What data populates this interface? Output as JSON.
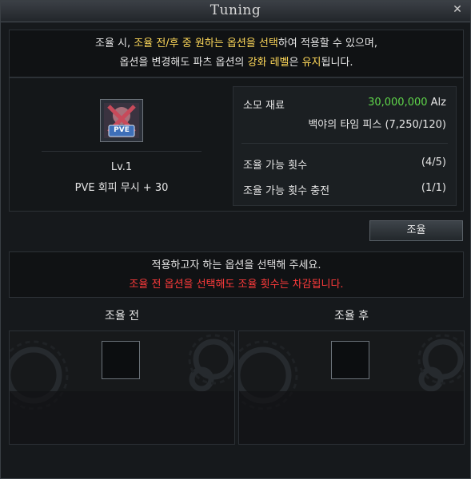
{
  "window": {
    "title": "Tuning",
    "close_icon": "close-icon"
  },
  "notice_top": {
    "line1": [
      {
        "text": "조율 시, ",
        "color": "white"
      },
      {
        "text": "조율 전/후 중 원하는 옵션을 선택",
        "color": "yellow"
      },
      {
        "text": "하여 적용할 수 있으며,",
        "color": "white"
      }
    ],
    "line2": [
      {
        "text": "옵션을 변경해도 파츠 옵션의 ",
        "color": "white"
      },
      {
        "text": "강화 레벨",
        "color": "yellow"
      },
      {
        "text": "은 ",
        "color": "white"
      },
      {
        "text": "유지",
        "color": "yellow"
      },
      {
        "text": "됩니다.",
        "color": "white"
      }
    ]
  },
  "item": {
    "icon": "pve-item-icon",
    "icon_label": "PVE",
    "level": "Lv.1",
    "option": "PVE 회피 무시  + 30"
  },
  "cost": {
    "label": "소모 재료",
    "amount": "30,000,000",
    "currency": "Alz",
    "material": "백야의 타임 피스 (7,250/120)"
  },
  "tuning": {
    "count_label": "조율 가능 횟수",
    "count_value": "(4/5)",
    "recharge_label": "조율 가능 횟수 충전",
    "recharge_value": "(1/1)"
  },
  "tune_button": "조율",
  "notice_bottom": {
    "line1": "적용하고자 하는 옵션을 선택해 주세요.",
    "line2": "조율 전 옵션을 선택해도 조율 횟수는 차감됩니다."
  },
  "columns": {
    "before": "조율 전",
    "after": "조율 후"
  },
  "colors": {
    "yellow": "#ffd95a",
    "red": "#ff3b3b",
    "green": "#5fd64a"
  }
}
